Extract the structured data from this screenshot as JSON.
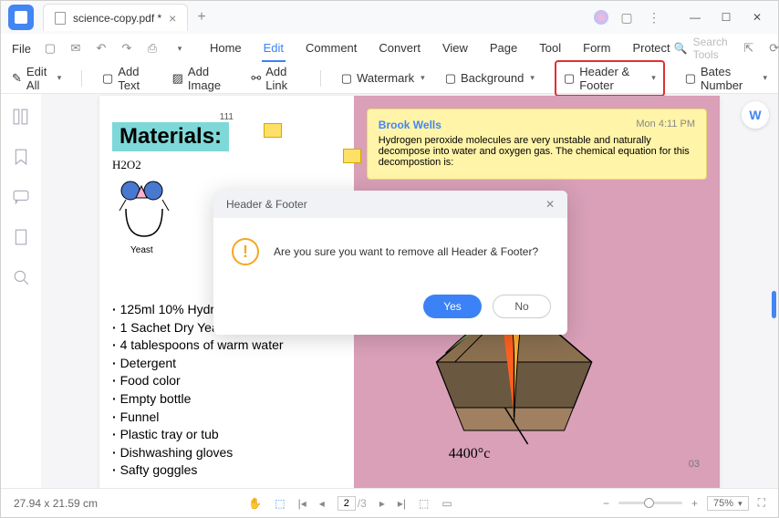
{
  "titlebar": {
    "tab_title": "science-copy.pdf *"
  },
  "menu": {
    "file": "File",
    "tabs": [
      "Home",
      "Edit",
      "Comment",
      "Convert",
      "View",
      "Page",
      "Tool",
      "Form",
      "Protect"
    ],
    "active_tab_index": 1,
    "search_placeholder": "Search Tools"
  },
  "toolbar": {
    "edit_all": "Edit All",
    "add_text": "Add Text",
    "add_image": "Add Image",
    "add_link": "Add Link",
    "watermark": "Watermark",
    "background": "Background",
    "header_footer": "Header & Footer",
    "bates_number": "Bates Number"
  },
  "document": {
    "page_header_num": "111",
    "materials_title": "Materials:",
    "h2o2_label": "H2O2",
    "yeast_label": "Yeast",
    "materials_list": [
      "125ml 10% Hydrogen Peroxide",
      "1 Sachet Dry Yeast (powder)",
      "4 tablespoons of warm water",
      "Detergent",
      "Food color",
      "Empty bottle",
      "Funnel",
      "Plastic tray or tub",
      "Dishwashing gloves",
      "Safty goggles"
    ],
    "comment": {
      "author": "Brook Wells",
      "time": "Mon 4:11 PM",
      "text": "Hydrogen peroxide molecules are very unstable and naturally decompose into water and oxygen gas. The chemical equation for this decompostion is:"
    },
    "temperature": "4400°c",
    "page_num_right": "03"
  },
  "dialog": {
    "title": "Header & Footer",
    "message": "Are you sure you want to remove all Header & Footer?",
    "yes": "Yes",
    "no": "No"
  },
  "statusbar": {
    "dimensions": "27.94 x 21.59 cm",
    "current_page": "2",
    "total_pages": "/3",
    "zoom": "75%"
  }
}
